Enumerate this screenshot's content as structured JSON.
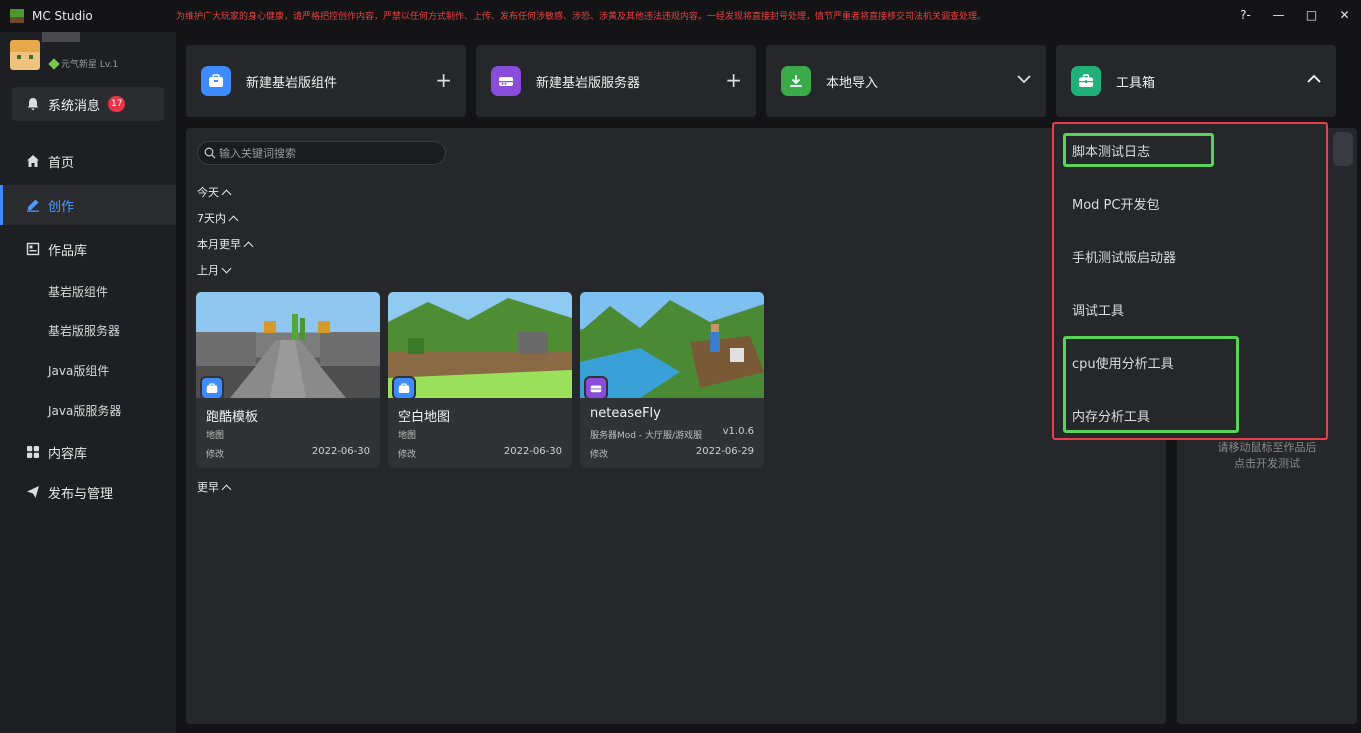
{
  "app": {
    "title": "MC Studio",
    "notice": "为维护广大玩家的身心健康，请严格把控创作内容，严禁以任何方式制作、上传、发布任何涉敏感、涉恐、涉黄及其他违法违规内容。一经发现将直接封号处理，情节严重者将直接移交司法机关调查处理。",
    "window_buttons": [
      "?-",
      "—",
      "□",
      "✕"
    ]
  },
  "user": {
    "level": "元气新星 Lv.1"
  },
  "sidebar": {
    "system_message": {
      "label": "系统消息",
      "badge": "17"
    },
    "nav": [
      {
        "label": "首页",
        "icon": "home-icon"
      },
      {
        "label": "创作",
        "icon": "edit-icon",
        "active": true
      },
      {
        "label": "作品库",
        "icon": "library-icon"
      }
    ],
    "library_sub": [
      "基岩版组件",
      "基岩版服务器",
      "Java版组件",
      "Java版服务器"
    ],
    "nav_bottom": [
      {
        "label": "内容库",
        "icon": "grid-icon"
      },
      {
        "label": "发布与管理",
        "icon": "send-icon"
      }
    ]
  },
  "top_cards": [
    {
      "label": "新建基岩版组件",
      "action": "+",
      "color": "#3d8bff"
    },
    {
      "label": "新建基岩版服务器",
      "action": "+",
      "color": "#8a4ddb"
    },
    {
      "label": "本地导入",
      "action": "chevron-down",
      "color": "#3aaa4a"
    },
    {
      "label": "工具箱",
      "action": "chevron-up",
      "color": "#21b07a"
    }
  ],
  "search": {
    "placeholder": "输入关键词搜索"
  },
  "groups": {
    "today": "今天",
    "week": "7天内",
    "month": "本月更早",
    "last_month": "上月",
    "earlier": "更早"
  },
  "works": [
    {
      "title": "跑酷模板",
      "type": "地图",
      "modified": "修改",
      "date": "2022-06-30",
      "version": ""
    },
    {
      "title": "空白地图",
      "type": "地图",
      "modified": "修改",
      "date": "2022-06-30",
      "version": ""
    },
    {
      "title": "neteaseFly",
      "type": "服务器Mod - 大厅服/游戏服",
      "modified": "修改",
      "date": "2022-06-29",
      "version": "v1.0.6"
    }
  ],
  "toolbox_menu": [
    "脚本测试日志",
    "Mod PC开发包",
    "手机测试版启动器",
    "调试工具",
    "cpu使用分析工具",
    "内存分析工具"
  ],
  "right_panel": {
    "hint_line1": "请移动鼠标至作品后",
    "hint_line2": "点击开发测试"
  }
}
